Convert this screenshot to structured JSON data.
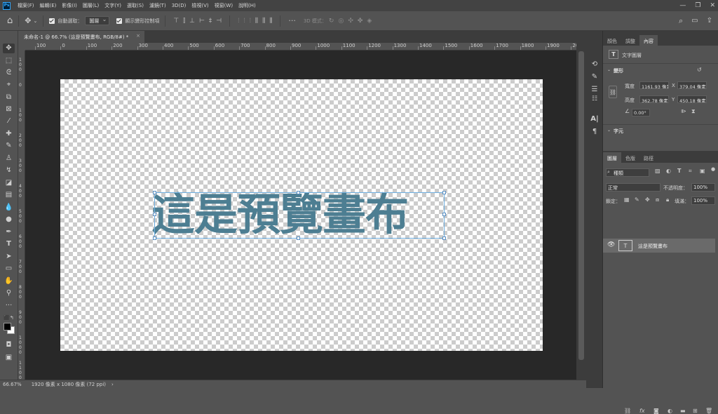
{
  "app": {
    "logo": "Ps"
  },
  "menu": [
    "檔案(F)",
    "編輯(E)",
    "影像(I)",
    "圖層(L)",
    "文字(Y)",
    "選取(S)",
    "濾鏡(T)",
    "3D(D)",
    "檢視(V)",
    "視窗(W)",
    "說明(H)"
  ],
  "window_controls": {
    "minimize": "—",
    "restore": "❐",
    "close": "✕"
  },
  "options": {
    "auto_select_label": "自動選取：",
    "auto_select_target": "圖層",
    "show_transform_label": "顯示變形控制項",
    "mode_3d_label": "3D 模式："
  },
  "document_tab": {
    "title": "未命名-1 @ 66.7% (這是預覽畫布, RGB/8#) *",
    "close": "×"
  },
  "ruler_top": [
    "100",
    "0",
    "100",
    "200",
    "300",
    "400",
    "500",
    "600",
    "700",
    "800",
    "900",
    "1000",
    "1100",
    "1200",
    "1300",
    "1400",
    "1500",
    "1600",
    "1700",
    "1800",
    "1900",
    "2000"
  ],
  "ruler_left": [
    "100",
    "0",
    "100",
    "200",
    "300",
    "400",
    "500",
    "600",
    "700",
    "800",
    "900",
    "1000",
    "1100"
  ],
  "canvas_text": "這是預覽畫布",
  "status": {
    "zoom": "66.67%",
    "doc_info": "1920 像素 x 1080 像素 (72 ppi)",
    "arrow": "›"
  },
  "properties_panel": {
    "tabs": [
      "顏色",
      "調整",
      "內容"
    ],
    "active_tab": "內容",
    "layer_type": "文字圖層",
    "transform_section": "變形",
    "width_label": "寬度",
    "width_value": "1161.93 像素",
    "x_label": "X",
    "x_value": "379.04 像素",
    "height_label": "高度",
    "height_value": "362.78 像素",
    "y_label": "Y",
    "y_value": "450.18 像素",
    "angle_value": "0.00°",
    "character_section": "字元"
  },
  "layers_panel": {
    "tabs": [
      "圖層",
      "色版",
      "路徑"
    ],
    "active_tab": "圖層",
    "filter_kind": "種類",
    "blend_mode": "正常",
    "opacity_label": "不透明度：",
    "opacity_value": "100%",
    "lock_label": "鎖定：",
    "fill_label": "填滿：",
    "fill_value": "100%",
    "layers": [
      {
        "name": "這是預覽畫布",
        "type": "T",
        "visible": true
      }
    ],
    "bottom_icons": [
      "link",
      "fx",
      "mask",
      "adjust",
      "group",
      "new",
      "delete"
    ]
  },
  "colors": {
    "text_color": "#4d7e92",
    "foreground": "#000000",
    "background": "#ffffff"
  }
}
